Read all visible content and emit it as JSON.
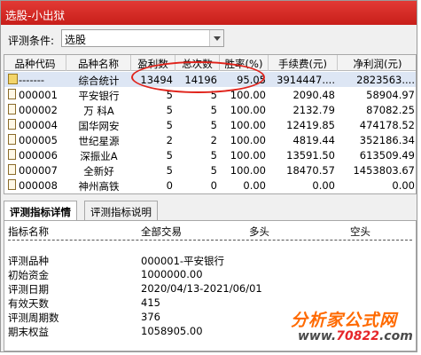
{
  "window": {
    "title": "选股-小出狱"
  },
  "condition": {
    "label": "评测条件:",
    "value": "选股"
  },
  "table": {
    "columns": [
      "品种代码",
      "品种名称",
      "盈利数",
      "总次数",
      "胜率(%)",
      "手续费(元)",
      "净利润(元)"
    ],
    "rows": [
      {
        "code": "-------",
        "name": "综合统计",
        "wins": "13494",
        "total": "14196",
        "winrate": "95.05",
        "fee": "3914447....",
        "profit": "2823563...."
      },
      {
        "code": "000001",
        "name": "平安银行",
        "wins": "5",
        "total": "5",
        "winrate": "100.00",
        "fee": "2090.48",
        "profit": "58904.97"
      },
      {
        "code": "000002",
        "name": "万 科A",
        "wins": "5",
        "total": "5",
        "winrate": "100.00",
        "fee": "2132.79",
        "profit": "87082.25"
      },
      {
        "code": "000004",
        "name": "国华网安",
        "wins": "5",
        "total": "5",
        "winrate": "100.00",
        "fee": "12419.85",
        "profit": "474178.52"
      },
      {
        "code": "000005",
        "name": "世纪星源",
        "wins": "2",
        "total": "2",
        "winrate": "100.00",
        "fee": "4819.44",
        "profit": "352186.34"
      },
      {
        "code": "000006",
        "name": "深振业A",
        "wins": "5",
        "total": "5",
        "winrate": "100.00",
        "fee": "13591.50",
        "profit": "613509.49"
      },
      {
        "code": "000007",
        "name": "全新好",
        "wins": "5",
        "total": "5",
        "winrate": "100.00",
        "fee": "18470.57",
        "profit": "1453803.67"
      },
      {
        "code": "000008",
        "name": "神州高铁",
        "wins": "0",
        "total": "0",
        "winrate": "0.00",
        "fee": "0.00",
        "profit": "0.00"
      }
    ]
  },
  "tabs": [
    "评测指标详情",
    "评测指标说明"
  ],
  "details": {
    "headers": [
      "指标名称",
      "全部交易",
      "多头",
      "空头"
    ],
    "rows": [
      {
        "label": "评测品种",
        "value": "000001-平安银行"
      },
      {
        "label": "初始资金",
        "value": "1000000.00"
      },
      {
        "label": "评测日期",
        "value": "2020/04/13-2021/06/01"
      },
      {
        "label": "有效天数",
        "value": "415"
      },
      {
        "label": "评测周期数",
        "value": "376"
      },
      {
        "label": "期末权益",
        "value": "1058905.00"
      }
    ]
  },
  "watermark": {
    "brand": "分析家公式网",
    "url_prefix": "www.",
    "url_number": "70822",
    "url_suffix": ".com"
  },
  "colors": {
    "title_bar": "#d42a25",
    "highlight_ellipse": "#e0231b",
    "selected_row": "#dde6f4",
    "logo_orange": "#ff6a00"
  }
}
